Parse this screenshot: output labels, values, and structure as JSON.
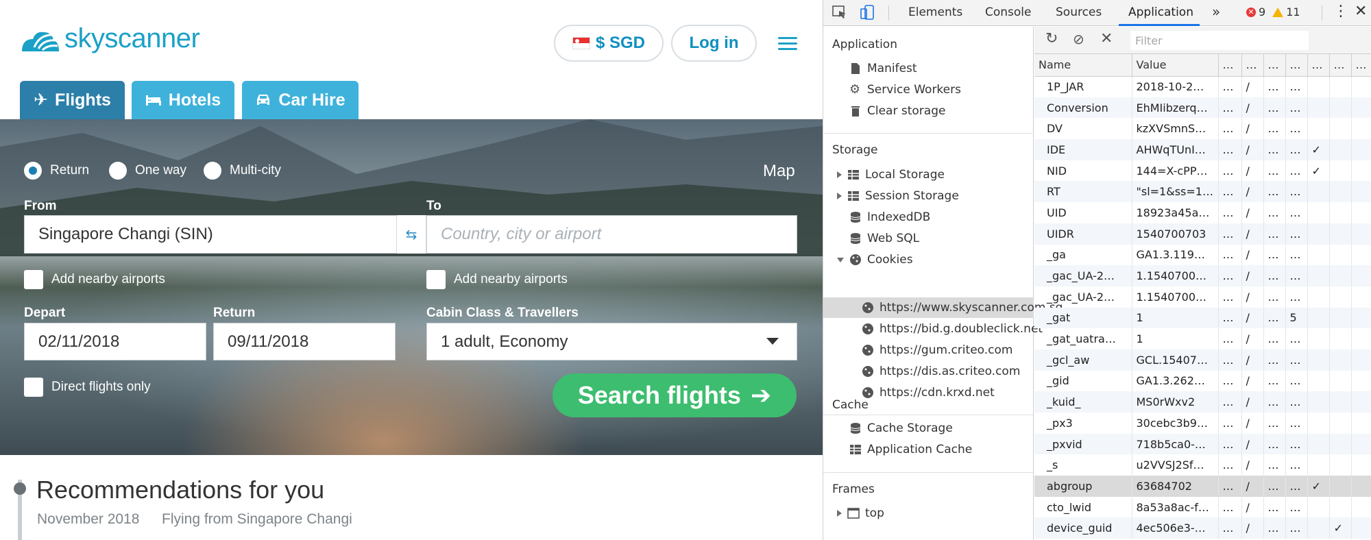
{
  "site": {
    "logo_text": "skyscanner",
    "currency_button": "$ SGD",
    "login_button": "Log in",
    "tabs": [
      {
        "label": "Flights"
      },
      {
        "label": "Hotels"
      },
      {
        "label": "Car Hire"
      }
    ],
    "trip_types": [
      {
        "label": "Return",
        "selected": true
      },
      {
        "label": "One way",
        "selected": false
      },
      {
        "label": "Multi-city",
        "selected": false
      }
    ],
    "map_link": "Map",
    "from_label": "From",
    "from_value": "Singapore Changi (SIN)",
    "to_label": "To",
    "to_placeholder": "Country, city or airport",
    "add_nearby_from": "Add nearby airports",
    "add_nearby_to": "Add nearby airports",
    "depart_label": "Depart",
    "depart_value": "02/11/2018",
    "return_label": "Return",
    "return_value": "09/11/2018",
    "cabin_label": "Cabin Class & Travellers",
    "cabin_value": "1 adult, Economy",
    "direct_only": "Direct flights only",
    "search_button": "Search flights",
    "search_arrow": "➔",
    "reco_title": "Recommendations for you",
    "reco_month": "November 2018",
    "reco_from": "Flying from Singapore Changi"
  },
  "devtools": {
    "tabs": [
      "Elements",
      "Console",
      "Sources",
      "Application"
    ],
    "active_tab": "Application",
    "more": "»",
    "errors": "9",
    "warnings": "11",
    "kebab": "⋮",
    "sidebar": {
      "application_title": "Application",
      "application_items": [
        "Manifest",
        "Service Workers",
        "Clear storage"
      ],
      "storage_title": "Storage",
      "storage_items": [
        "Local Storage",
        "Session Storage",
        "IndexedDB",
        "Web SQL",
        "Cookies"
      ],
      "cookie_domains": [
        "https://www.skyscanner.com.sg",
        "https://bid.g.doubleclick.net",
        "https://gum.criteo.com",
        "https://dis.as.criteo.com",
        "https://cdn.krxd.net"
      ],
      "cache_title": "Cache",
      "cache_items": [
        "Cache Storage",
        "Application Cache"
      ],
      "frames_title": "Frames",
      "frames_items": [
        "top"
      ]
    },
    "filter_placeholder": "Filter",
    "columns": [
      "Name",
      "Value",
      "…",
      "…",
      "…",
      "…",
      "…",
      "…",
      "…"
    ],
    "rows": [
      {
        "name": "1P_JAR",
        "value": "2018-10-2…",
        "c3": "…",
        "c4": "/",
        "c5": "…",
        "c6": "…",
        "c7": "",
        "c8": ""
      },
      {
        "name": "Conversion",
        "value": "EhMIibzerq…",
        "c3": "…",
        "c4": "/",
        "c5": "…",
        "c6": "…",
        "c7": "",
        "c8": ""
      },
      {
        "name": "DV",
        "value": "kzXVSmnS…",
        "c3": "…",
        "c4": "/",
        "c5": "…",
        "c6": "…",
        "c7": "",
        "c8": ""
      },
      {
        "name": "IDE",
        "value": "AHWqTUnI…",
        "c3": "…",
        "c4": "/",
        "c5": "…",
        "c6": "…",
        "c7": "✓",
        "c8": ""
      },
      {
        "name": "NID",
        "value": "144=X-cPP…",
        "c3": "…",
        "c4": "/",
        "c5": "…",
        "c6": "…",
        "c7": "✓",
        "c8": ""
      },
      {
        "name": "RT",
        "value": "\"sl=1&ss=1…",
        "c3": "…",
        "c4": "/",
        "c5": "…",
        "c6": "…",
        "c7": "",
        "c8": ""
      },
      {
        "name": "UID",
        "value": "18923a45a…",
        "c3": "…",
        "c4": "/",
        "c5": "…",
        "c6": "…",
        "c7": "",
        "c8": ""
      },
      {
        "name": "UIDR",
        "value": "1540700703",
        "c3": "…",
        "c4": "/",
        "c5": "…",
        "c6": "…",
        "c7": "",
        "c8": ""
      },
      {
        "name": "_ga",
        "value": "GA1.3.119…",
        "c3": "…",
        "c4": "/",
        "c5": "…",
        "c6": "…",
        "c7": "",
        "c8": ""
      },
      {
        "name": "_gac_UA-2…",
        "value": "1.1540700…",
        "c3": "…",
        "c4": "/",
        "c5": "…",
        "c6": "…",
        "c7": "",
        "c8": ""
      },
      {
        "name": "_gac_UA-2…",
        "value": "1.1540700…",
        "c3": "…",
        "c4": "/",
        "c5": "…",
        "c6": "…",
        "c7": "",
        "c8": ""
      },
      {
        "name": "_gat",
        "value": "1",
        "c3": "…",
        "c4": "/",
        "c5": "…",
        "c6": "5",
        "c7": "",
        "c8": ""
      },
      {
        "name": "_gat_uatra…",
        "value": "1",
        "c3": "…",
        "c4": "/",
        "c5": "…",
        "c6": "…",
        "c7": "",
        "c8": ""
      },
      {
        "name": "_gcl_aw",
        "value": "GCL.15407…",
        "c3": "…",
        "c4": "/",
        "c5": "…",
        "c6": "…",
        "c7": "",
        "c8": ""
      },
      {
        "name": "_gid",
        "value": "GA1.3.262…",
        "c3": "…",
        "c4": "/",
        "c5": "…",
        "c6": "…",
        "c7": "",
        "c8": ""
      },
      {
        "name": "_kuid_",
        "value": "MS0rWxv2",
        "c3": "…",
        "c4": "/",
        "c5": "…",
        "c6": "…",
        "c7": "",
        "c8": ""
      },
      {
        "name": "_px3",
        "value": "30cebc3b9…",
        "c3": "…",
        "c4": "/",
        "c5": "…",
        "c6": "…",
        "c7": "",
        "c8": ""
      },
      {
        "name": "_pxvid",
        "value": "718b5ca0-…",
        "c3": "…",
        "c4": "/",
        "c5": "…",
        "c6": "…",
        "c7": "",
        "c8": ""
      },
      {
        "name": "_s",
        "value": "u2VVSJ2Sf…",
        "c3": "…",
        "c4": "/",
        "c5": "…",
        "c6": "…",
        "c7": "",
        "c8": ""
      },
      {
        "name": "abgroup",
        "value": "63684702",
        "c3": "…",
        "c4": "/",
        "c5": "…",
        "c6": "…",
        "c7": "✓",
        "c8": ""
      },
      {
        "name": "cto_lwid",
        "value": "8a53a8ac-f…",
        "c3": "…",
        "c4": "/",
        "c5": "…",
        "c6": "…",
        "c7": "",
        "c8": ""
      },
      {
        "name": "device_guid",
        "value": "4ec506e3-…",
        "c3": "…",
        "c4": "/",
        "c5": "…",
        "c6": "…",
        "c7": "",
        "c8": "✓"
      }
    ],
    "highlighted_row": "abgroup"
  }
}
